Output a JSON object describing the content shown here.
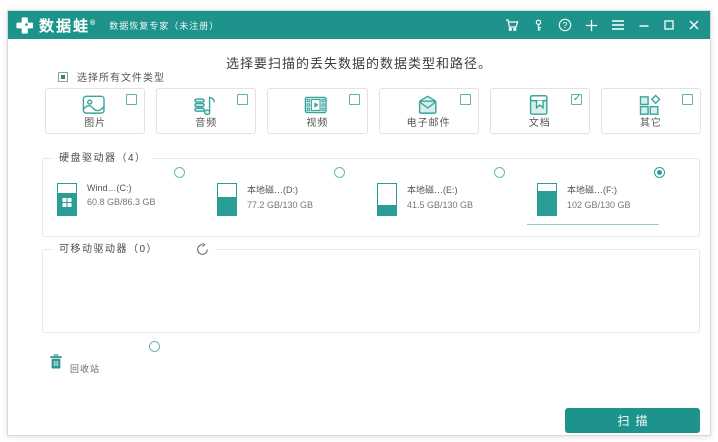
{
  "titlebar": {
    "logo_text": "数据蛙",
    "logo_mark": "®",
    "subtitle": "数据恢复专家（未注册）",
    "icons": [
      "cart-icon",
      "key-icon",
      "help-icon",
      "plus-icon",
      "menu-icon",
      "minimize-icon",
      "maximize-icon",
      "close-icon"
    ]
  },
  "heading": "选择要扫描的丢失数据的数据类型和路径。",
  "select_all": {
    "label": "选择所有文件类型",
    "state": "indeterminate"
  },
  "file_types": [
    {
      "label": "图片",
      "icon": "image-icon",
      "checked": false
    },
    {
      "label": "音频",
      "icon": "audio-icon",
      "checked": false
    },
    {
      "label": "视频",
      "icon": "video-icon",
      "checked": false
    },
    {
      "label": "电子邮件",
      "icon": "email-icon",
      "checked": false
    },
    {
      "label": "文档",
      "icon": "document-icon",
      "checked": true
    },
    {
      "label": "其它",
      "icon": "other-icon",
      "checked": false
    }
  ],
  "hard_drives": {
    "legend": "硬盘驱动器（4）",
    "drives": [
      {
        "name": "Wind…(C:)",
        "capacity": "60.8 GB/86.3 GB",
        "selected": false,
        "fill_pct": 70,
        "windows_logo": true
      },
      {
        "name": "本地磁…(D:)",
        "capacity": "77.2 GB/130 GB",
        "selected": false,
        "fill_pct": 59,
        "windows_logo": false
      },
      {
        "name": "本地磁…(E:)",
        "capacity": "41.5 GB/130 GB",
        "selected": false,
        "fill_pct": 32,
        "windows_logo": false
      },
      {
        "name": "本地磁…(F:)",
        "capacity": "102 GB/130 GB",
        "selected": true,
        "fill_pct": 78,
        "windows_logo": false
      }
    ]
  },
  "removable_drives": {
    "legend": "可移动驱动器（0）",
    "count": 0
  },
  "recycle_bin": {
    "label": "回收站",
    "selected": false
  },
  "scan_button": "扫描",
  "colors": {
    "titlebar_bg": "#1d938c",
    "accent": "#2a9d96",
    "icon_stroke": "#3aa49d",
    "icon_fill": "#d9efed",
    "underline": "#8fd0cb"
  }
}
